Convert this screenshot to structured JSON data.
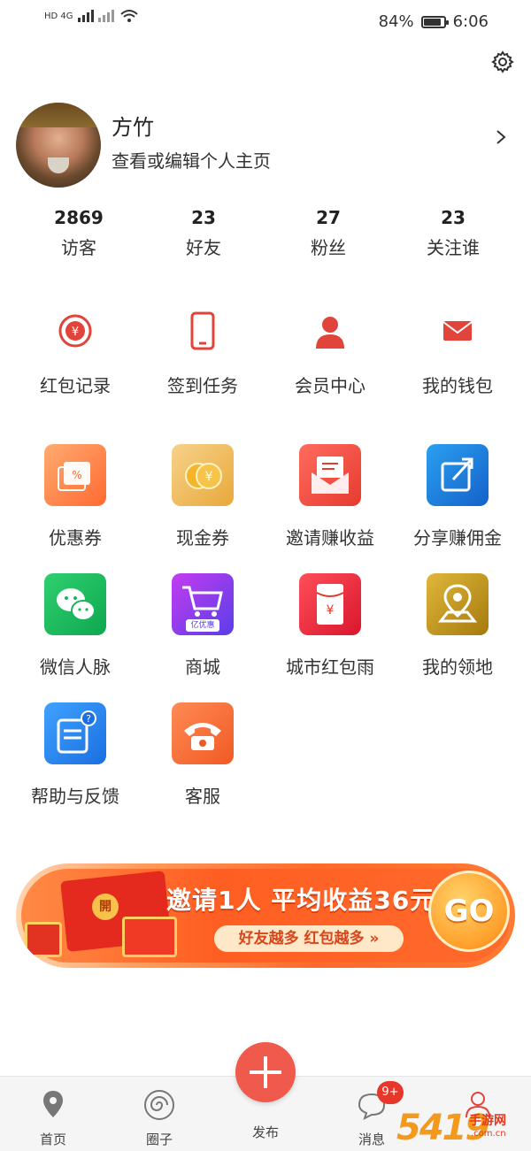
{
  "status_bar": {
    "left_text": "HD",
    "network": "4G",
    "battery": "84%",
    "time": "6:06"
  },
  "profile": {
    "name": "方竹",
    "subtitle": "查看或编辑个人主页"
  },
  "stats": [
    {
      "value": "2869",
      "label": "访客"
    },
    {
      "value": "23",
      "label": "好友"
    },
    {
      "value": "27",
      "label": "粉丝"
    },
    {
      "value": "23",
      "label": "关注谁"
    }
  ],
  "quick": [
    {
      "label": "红包记录",
      "icon": "yuan-refresh-icon"
    },
    {
      "label": "签到任务",
      "icon": "phone-icon"
    },
    {
      "label": "会员中心",
      "icon": "person-icon"
    },
    {
      "label": "我的钱包",
      "icon": "envelope-icon"
    }
  ],
  "grid": [
    {
      "label": "优惠券",
      "icon": "coupon-icon"
    },
    {
      "label": "现金券",
      "icon": "coins-icon"
    },
    {
      "label": "邀请赚收益",
      "icon": "invite-envelope-icon"
    },
    {
      "label": "分享赚佣金",
      "icon": "share-icon"
    },
    {
      "label": "微信人脉",
      "icon": "wechat-icon"
    },
    {
      "label": "商城",
      "icon": "cart-icon",
      "badge": "亿优惠"
    },
    {
      "label": "城市红包雨",
      "icon": "red-packet-icon"
    },
    {
      "label": "我的领地",
      "icon": "map-pin-icon"
    },
    {
      "label": "帮助与反馈",
      "icon": "feedback-icon"
    },
    {
      "label": "客服",
      "icon": "telephone-icon"
    }
  ],
  "banner": {
    "seal": "開",
    "title": "邀请1人 平均收益36元",
    "pill": "好友越多 红包越多 »",
    "go": "GO"
  },
  "nav": [
    {
      "label": "首页",
      "icon": "location-icon"
    },
    {
      "label": "圈子",
      "icon": "spiral-icon"
    },
    {
      "label": "发布",
      "icon": "plus-icon"
    },
    {
      "label": "消息",
      "icon": "chat-icon"
    },
    {
      "label": "",
      "icon": "profile-icon"
    }
  ],
  "message_badge": "9+",
  "watermark": {
    "big": "5419",
    "cn": "手游网",
    "domain": ".com.cn"
  },
  "colors": {
    "accent": "#e0443a",
    "nav_bg": "#f5f5f5"
  }
}
